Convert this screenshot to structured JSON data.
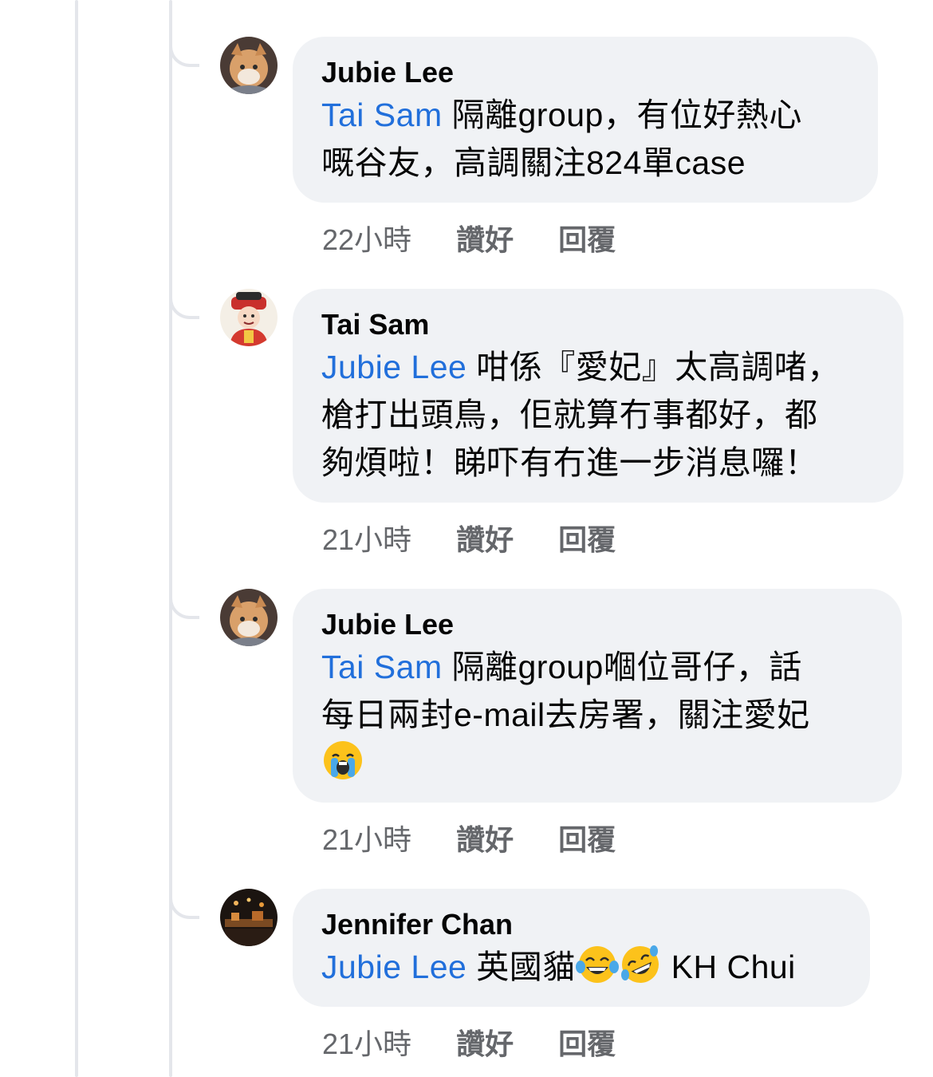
{
  "comments": [
    {
      "author": "Jubie Lee",
      "mention": "Tai Sam",
      "text_line1": " 隔離group，有位好熱心",
      "text_line2": "嘅谷友，高調關注824單case",
      "time": "22小時",
      "like": "讚好",
      "reply": "回覆",
      "avatar_icon": "cat-avatar-icon"
    },
    {
      "author": "Tai Sam",
      "mention": "Jubie Lee",
      "text_line1": " 咁係『愛妃』太高調啫，",
      "text_line2": "槍打出頭鳥，佢就算冇事都好，都",
      "text_line3": "夠煩啦！睇吓有冇進一步消息囉！",
      "time": "21小時",
      "like": "讚好",
      "reply": "回覆",
      "avatar_icon": "god-of-wealth-avatar-icon"
    },
    {
      "author": "Jubie Lee",
      "mention": "Tai Sam",
      "text_line1": " 隔離group嗰位哥仔，話",
      "text_line2": "每日兩封e-mail去房署，關注愛妃",
      "emoji": "crying-face-emoji",
      "time": "21小時",
      "like": "讚好",
      "reply": "回覆",
      "avatar_icon": "cat-avatar-icon"
    },
    {
      "author": "Jennifer Chan",
      "mention": "Jubie Lee",
      "text": " 英國貓",
      "emojis": [
        "tears-of-joy-emoji",
        "rolling-on-floor-laughing-emoji"
      ],
      "mention2": " KH Chui",
      "time": "21小時",
      "like": "讚好",
      "reply": "回覆",
      "avatar_icon": "night-scene-avatar-icon"
    }
  ],
  "colors": {
    "mention": "#216fdb",
    "bubble": "#f0f2f5",
    "meta": "#65676b",
    "thread_line": "#e4e6eb"
  }
}
